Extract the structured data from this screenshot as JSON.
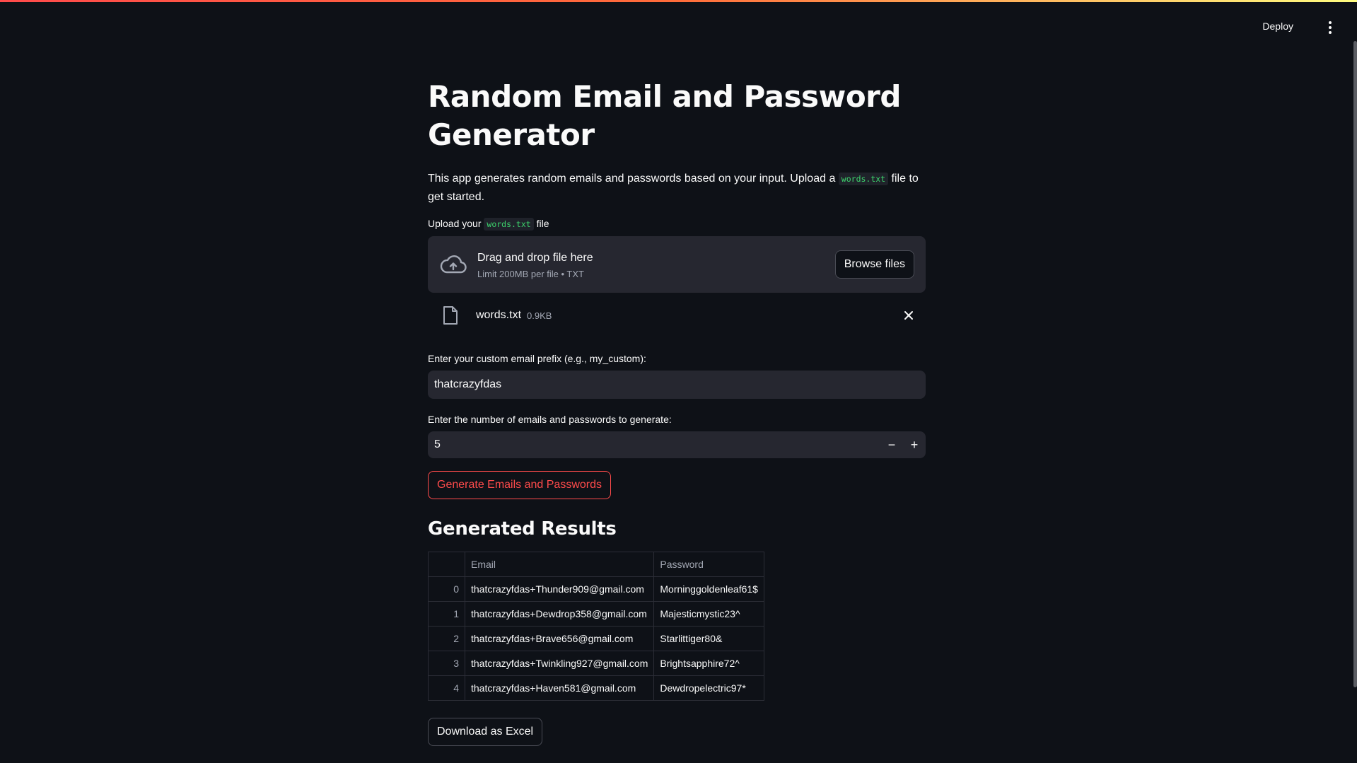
{
  "header": {
    "deploy_label": "Deploy",
    "menu_icon": "kebab-menu-icon"
  },
  "main": {
    "title": "Random Email and Password Generator",
    "intro_before": "This app generates random emails and passwords based on your input. Upload a ",
    "intro_code": "words.txt",
    "intro_after": " file to get started.",
    "upload": {
      "label_before": "Upload your ",
      "label_code": "words.txt",
      "label_after": " file",
      "drop_text": "Drag and drop file here",
      "limit_text": "Limit 200MB per file • TXT",
      "browse_label": "Browse files",
      "cloud_icon": "cloud-upload-icon"
    },
    "uploaded_file": {
      "name": "words.txt",
      "size": "0.9KB",
      "file_icon": "file-icon",
      "remove_icon": "close-icon"
    },
    "prefix_field": {
      "label": "Enter your custom email prefix (e.g., my_custom):",
      "value": "thatcrazyfdas"
    },
    "count_field": {
      "label": "Enter the number of emails and passwords to generate:",
      "value": "5",
      "minus": "−",
      "plus": "+"
    },
    "generate_label": "Generate Emails and Passwords",
    "results_title": "Generated Results",
    "table": {
      "columns": [
        "",
        "Email",
        "Password"
      ],
      "rows": [
        {
          "index": "0",
          "email": "thatcrazyfdas+Thunder909@gmail.com",
          "password": "Morninggoldenleaf61$"
        },
        {
          "index": "1",
          "email": "thatcrazyfdas+Dewdrop358@gmail.com",
          "password": "Majesticmystic23^"
        },
        {
          "index": "2",
          "email": "thatcrazyfdas+Brave656@gmail.com",
          "password": "Starlittiger80&"
        },
        {
          "index": "3",
          "email": "thatcrazyfdas+Twinkling927@gmail.com",
          "password": "Brightsapphire72^"
        },
        {
          "index": "4",
          "email": "thatcrazyfdas+Haven581@gmail.com",
          "password": "Dewdropelectric97*"
        }
      ]
    },
    "download_label": "Download as Excel"
  },
  "colors": {
    "background": "#0e1117",
    "accent": "#ff4b4b",
    "input_bg": "#262730",
    "code_text": "#3dd56d"
  }
}
